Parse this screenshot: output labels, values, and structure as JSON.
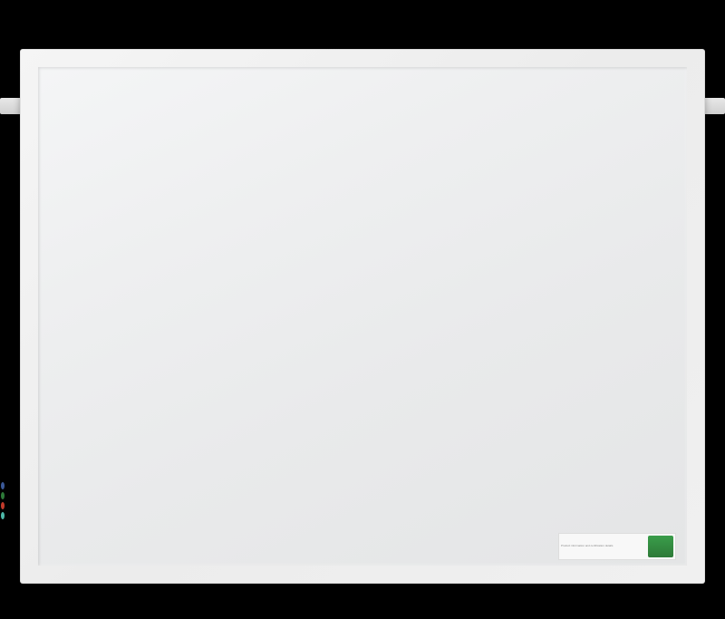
{
  "product": {
    "label_text": "Product information and certification details",
    "badge_color": "#2d7a38"
  },
  "markers": {
    "colors": [
      "blue",
      "green",
      "red",
      "teal"
    ]
  }
}
